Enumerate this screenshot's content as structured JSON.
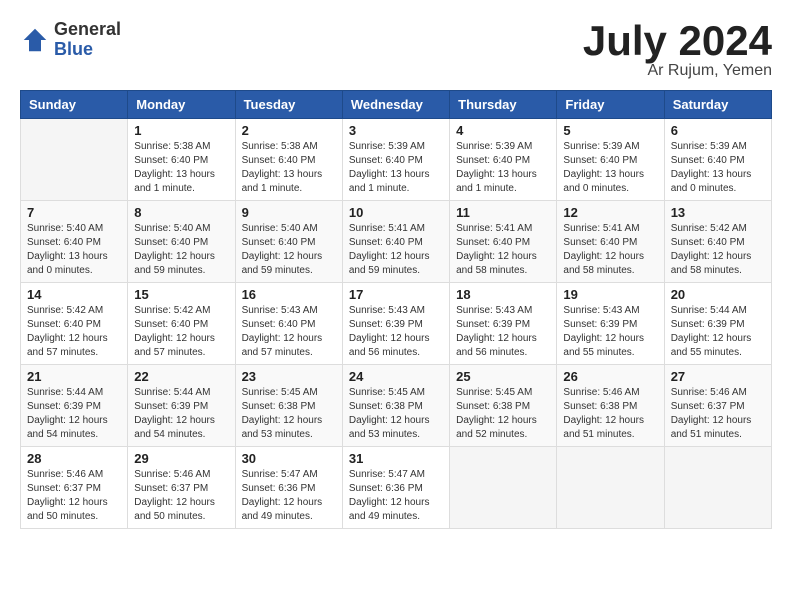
{
  "header": {
    "logo_general": "General",
    "logo_blue": "Blue",
    "month": "July 2024",
    "location": "Ar Rujum, Yemen"
  },
  "days_of_week": [
    "Sunday",
    "Monday",
    "Tuesday",
    "Wednesday",
    "Thursday",
    "Friday",
    "Saturday"
  ],
  "weeks": [
    [
      {
        "day": "",
        "info": ""
      },
      {
        "day": "1",
        "info": "Sunrise: 5:38 AM\nSunset: 6:40 PM\nDaylight: 13 hours and 1 minute."
      },
      {
        "day": "2",
        "info": "Sunrise: 5:38 AM\nSunset: 6:40 PM\nDaylight: 13 hours and 1 minute."
      },
      {
        "day": "3",
        "info": "Sunrise: 5:39 AM\nSunset: 6:40 PM\nDaylight: 13 hours and 1 minute."
      },
      {
        "day": "4",
        "info": "Sunrise: 5:39 AM\nSunset: 6:40 PM\nDaylight: 13 hours and 1 minute."
      },
      {
        "day": "5",
        "info": "Sunrise: 5:39 AM\nSunset: 6:40 PM\nDaylight: 13 hours and 0 minutes."
      },
      {
        "day": "6",
        "info": "Sunrise: 5:39 AM\nSunset: 6:40 PM\nDaylight: 13 hours and 0 minutes."
      }
    ],
    [
      {
        "day": "7",
        "info": "Sunrise: 5:40 AM\nSunset: 6:40 PM\nDaylight: 13 hours and 0 minutes."
      },
      {
        "day": "8",
        "info": "Sunrise: 5:40 AM\nSunset: 6:40 PM\nDaylight: 12 hours and 59 minutes."
      },
      {
        "day": "9",
        "info": "Sunrise: 5:40 AM\nSunset: 6:40 PM\nDaylight: 12 hours and 59 minutes."
      },
      {
        "day": "10",
        "info": "Sunrise: 5:41 AM\nSunset: 6:40 PM\nDaylight: 12 hours and 59 minutes."
      },
      {
        "day": "11",
        "info": "Sunrise: 5:41 AM\nSunset: 6:40 PM\nDaylight: 12 hours and 58 minutes."
      },
      {
        "day": "12",
        "info": "Sunrise: 5:41 AM\nSunset: 6:40 PM\nDaylight: 12 hours and 58 minutes."
      },
      {
        "day": "13",
        "info": "Sunrise: 5:42 AM\nSunset: 6:40 PM\nDaylight: 12 hours and 58 minutes."
      }
    ],
    [
      {
        "day": "14",
        "info": "Sunrise: 5:42 AM\nSunset: 6:40 PM\nDaylight: 12 hours and 57 minutes."
      },
      {
        "day": "15",
        "info": "Sunrise: 5:42 AM\nSunset: 6:40 PM\nDaylight: 12 hours and 57 minutes."
      },
      {
        "day": "16",
        "info": "Sunrise: 5:43 AM\nSunset: 6:40 PM\nDaylight: 12 hours and 57 minutes."
      },
      {
        "day": "17",
        "info": "Sunrise: 5:43 AM\nSunset: 6:39 PM\nDaylight: 12 hours and 56 minutes."
      },
      {
        "day": "18",
        "info": "Sunrise: 5:43 AM\nSunset: 6:39 PM\nDaylight: 12 hours and 56 minutes."
      },
      {
        "day": "19",
        "info": "Sunrise: 5:43 AM\nSunset: 6:39 PM\nDaylight: 12 hours and 55 minutes."
      },
      {
        "day": "20",
        "info": "Sunrise: 5:44 AM\nSunset: 6:39 PM\nDaylight: 12 hours and 55 minutes."
      }
    ],
    [
      {
        "day": "21",
        "info": "Sunrise: 5:44 AM\nSunset: 6:39 PM\nDaylight: 12 hours and 54 minutes."
      },
      {
        "day": "22",
        "info": "Sunrise: 5:44 AM\nSunset: 6:39 PM\nDaylight: 12 hours and 54 minutes."
      },
      {
        "day": "23",
        "info": "Sunrise: 5:45 AM\nSunset: 6:38 PM\nDaylight: 12 hours and 53 minutes."
      },
      {
        "day": "24",
        "info": "Sunrise: 5:45 AM\nSunset: 6:38 PM\nDaylight: 12 hours and 53 minutes."
      },
      {
        "day": "25",
        "info": "Sunrise: 5:45 AM\nSunset: 6:38 PM\nDaylight: 12 hours and 52 minutes."
      },
      {
        "day": "26",
        "info": "Sunrise: 5:46 AM\nSunset: 6:38 PM\nDaylight: 12 hours and 51 minutes."
      },
      {
        "day": "27",
        "info": "Sunrise: 5:46 AM\nSunset: 6:37 PM\nDaylight: 12 hours and 51 minutes."
      }
    ],
    [
      {
        "day": "28",
        "info": "Sunrise: 5:46 AM\nSunset: 6:37 PM\nDaylight: 12 hours and 50 minutes."
      },
      {
        "day": "29",
        "info": "Sunrise: 5:46 AM\nSunset: 6:37 PM\nDaylight: 12 hours and 50 minutes."
      },
      {
        "day": "30",
        "info": "Sunrise: 5:47 AM\nSunset: 6:36 PM\nDaylight: 12 hours and 49 minutes."
      },
      {
        "day": "31",
        "info": "Sunrise: 5:47 AM\nSunset: 6:36 PM\nDaylight: 12 hours and 49 minutes."
      },
      {
        "day": "",
        "info": ""
      },
      {
        "day": "",
        "info": ""
      },
      {
        "day": "",
        "info": ""
      }
    ]
  ]
}
